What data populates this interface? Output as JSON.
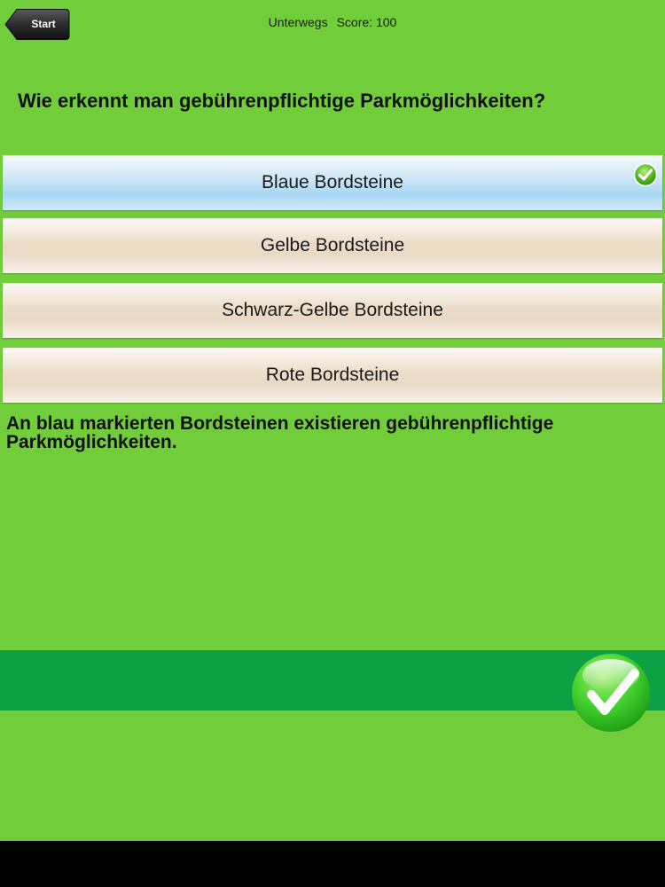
{
  "nav": {
    "back_label": "Start"
  },
  "status": {
    "mode": "Unterwegs",
    "score": "Score: 100"
  },
  "question": "Wie erkennt man gebührenpflichtige Parkmöglichkeiten?",
  "answers": [
    {
      "label": "Blaue Bordsteine",
      "state": "correct-selected"
    },
    {
      "label": "Gelbe Bordsteine",
      "state": "unselected"
    },
    {
      "label": "Schwarz-Gelbe Bordsteine",
      "state": "unselected"
    },
    {
      "label": "Rote Bordsteine",
      "state": "unselected"
    }
  ],
  "explanation": "An blau markierten Bordsteinen existieren gebührenpflichtige Parkmöglichkeiten.",
  "icons": {
    "answer_check": "check-icon",
    "next": "check-icon"
  },
  "colors": {
    "background": "#72cd3b",
    "band": "#0ea045",
    "selected_answer": "#a9d7f4",
    "answer": "#ebdcc8"
  }
}
